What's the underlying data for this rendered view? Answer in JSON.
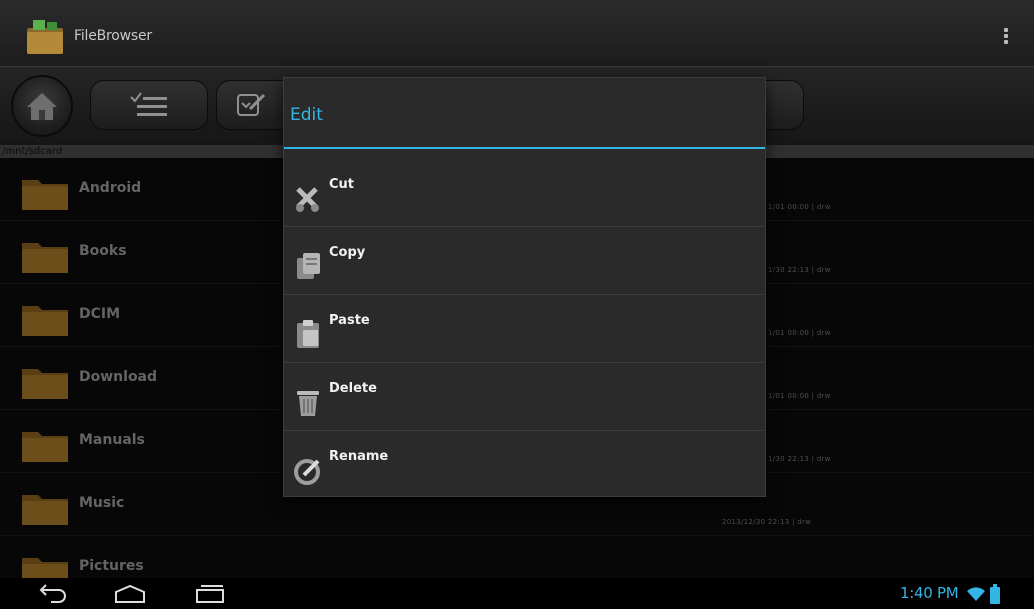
{
  "app": {
    "title": "FileBrowser"
  },
  "toolbar": {
    "home_icon": "home-icon",
    "list_icon": "multi-select-icon",
    "edit_icon": "edit-icon"
  },
  "path": {
    "current": "/mnt/sdcard"
  },
  "files": [
    {
      "name": "Android",
      "meta": "1/01 00:00 | drw"
    },
    {
      "name": "Books",
      "meta": "1/30 22:13 | drw"
    },
    {
      "name": "DCIM",
      "meta": "1/01 00:00 | drw"
    },
    {
      "name": "Download",
      "meta": "1/01 00:00 | drw"
    },
    {
      "name": "Manuals",
      "meta": "1/30 22:13 | drw"
    },
    {
      "name": "Music",
      "meta": "2013/12/30 22:13 | drw"
    },
    {
      "name": "Pictures",
      "meta": ""
    }
  ],
  "dialog": {
    "title": "Edit",
    "items": [
      {
        "label": "Cut",
        "icon": "scissors-icon"
      },
      {
        "label": "Copy",
        "icon": "copy-icon"
      },
      {
        "label": "Paste",
        "icon": "paste-icon"
      },
      {
        "label": "Delete",
        "icon": "trash-icon"
      },
      {
        "label": "Rename",
        "icon": "rename-icon"
      }
    ]
  },
  "status": {
    "time": "1:40 PM"
  },
  "colors": {
    "accent": "#33b5e5",
    "folder": "#a7782a"
  }
}
